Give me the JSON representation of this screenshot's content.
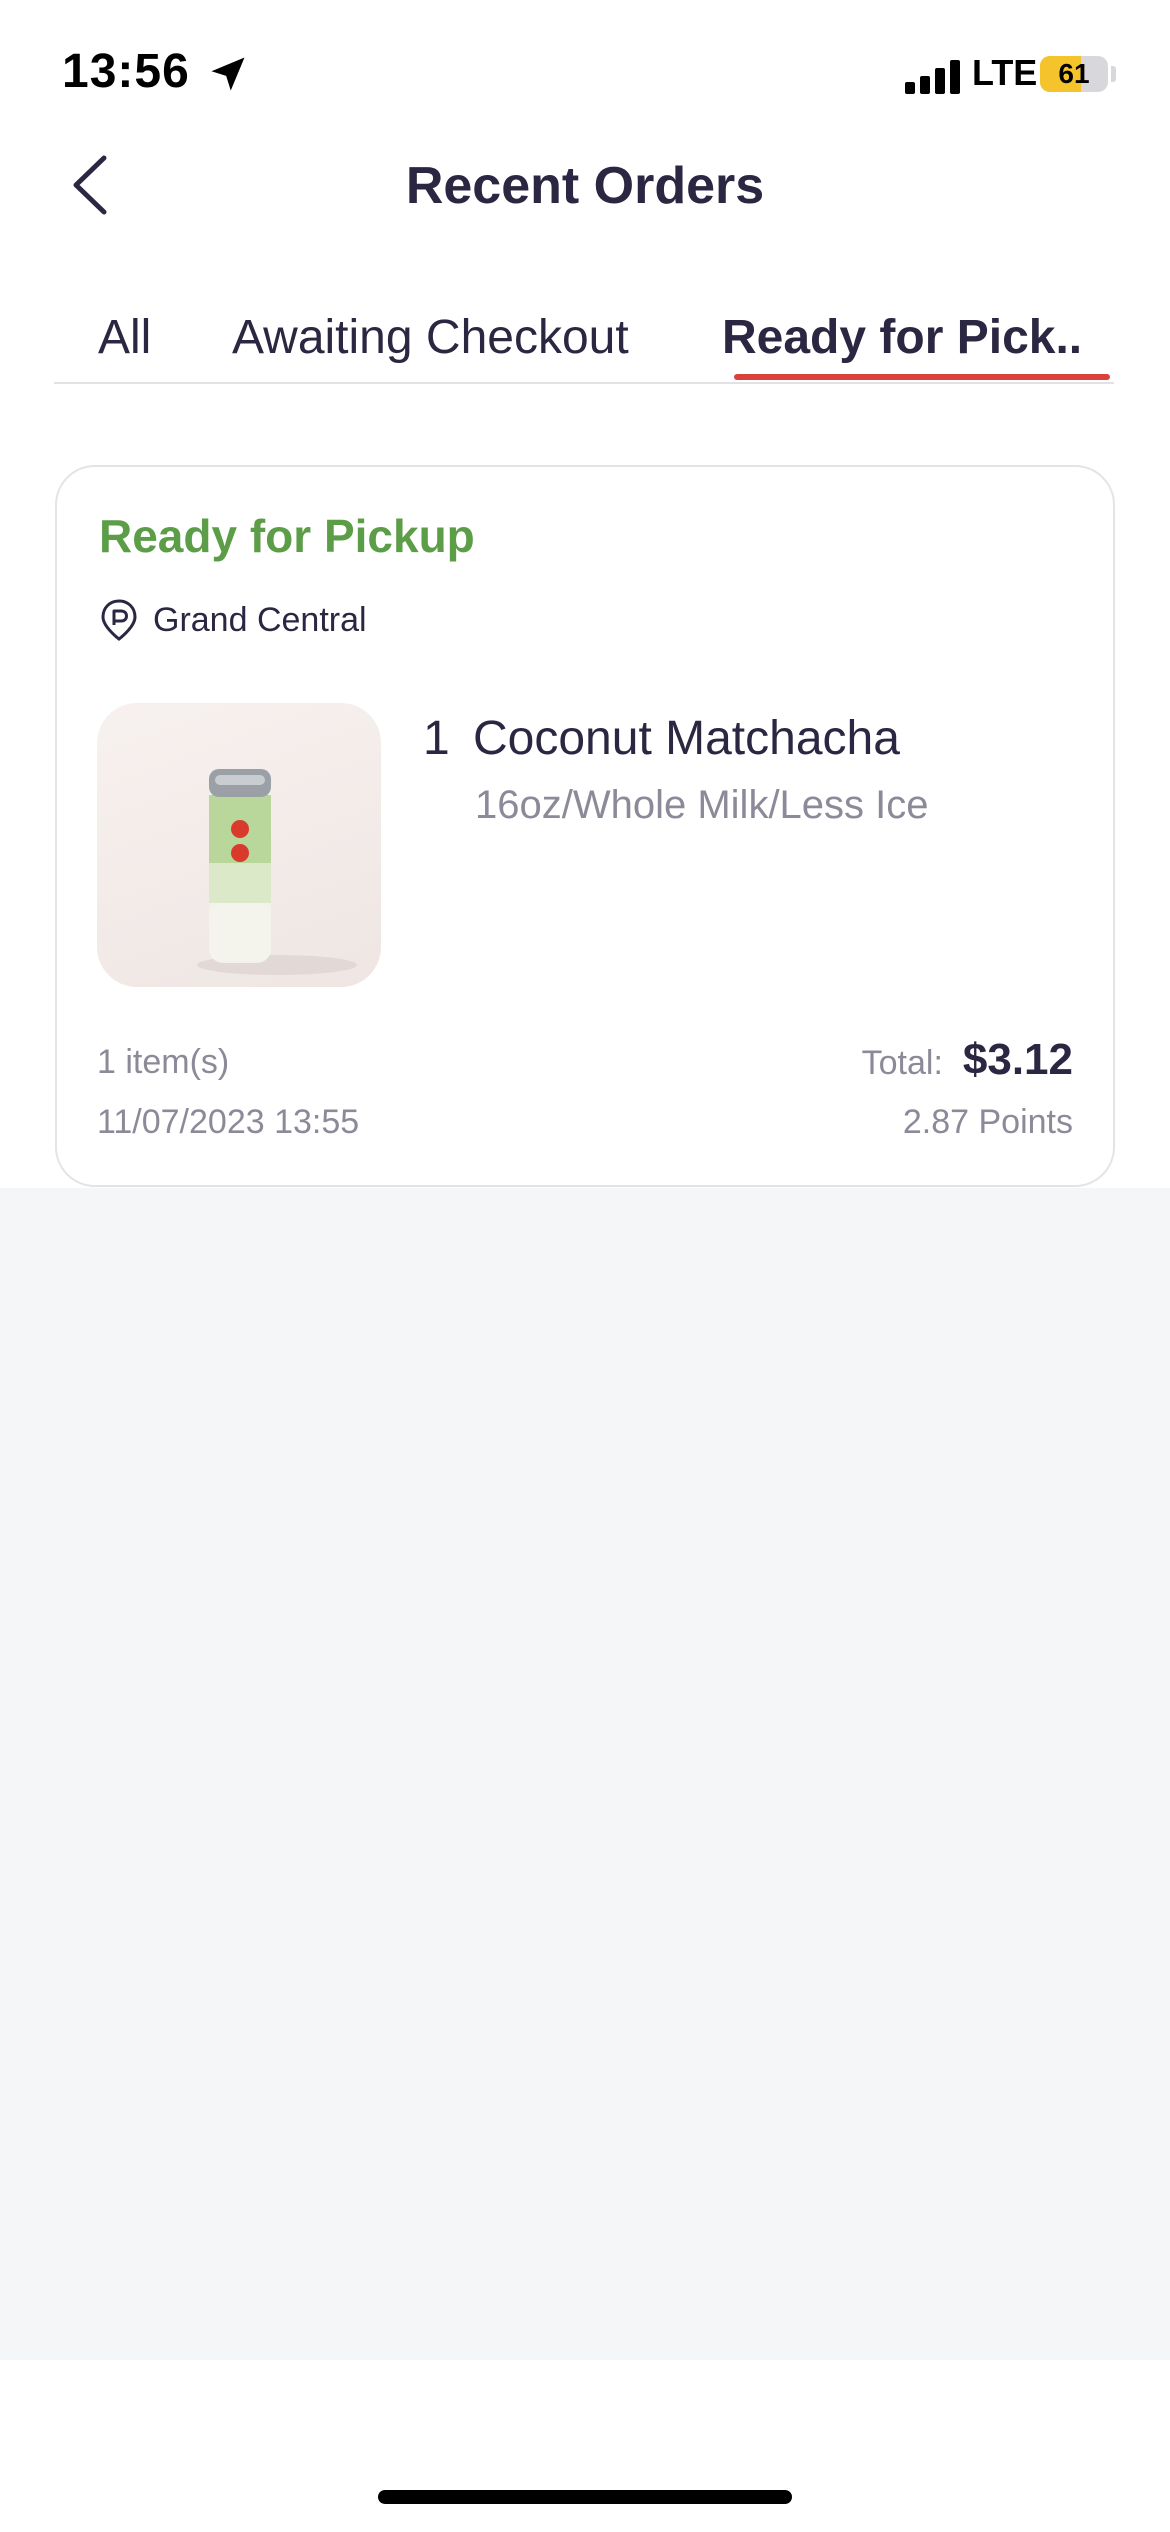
{
  "status_bar": {
    "time": "13:56",
    "network": "LTE",
    "battery": "61",
    "battery_level": 0.61,
    "battery_color": "#f5c42c"
  },
  "header": {
    "title": "Recent Orders"
  },
  "tabs": [
    {
      "label": "All",
      "active": false
    },
    {
      "label": "Awaiting Checkout",
      "active": false
    },
    {
      "label": "Ready for Pick..",
      "active": true
    }
  ],
  "accent_color": "#d9423b",
  "order": {
    "status": "Ready for Pickup",
    "status_color": "#5c9d48",
    "store": "Grand Central",
    "items": [
      {
        "qty": "1",
        "name": "Coconut Matchacha",
        "options": "16oz/Whole Milk/Less Ice",
        "image_icon": "drink-can-image"
      }
    ],
    "item_count": "1 item(s)",
    "date": "11/07/2023 13:55",
    "total_label": "Total:",
    "total": "$3.12",
    "points": "2.87 Points"
  }
}
